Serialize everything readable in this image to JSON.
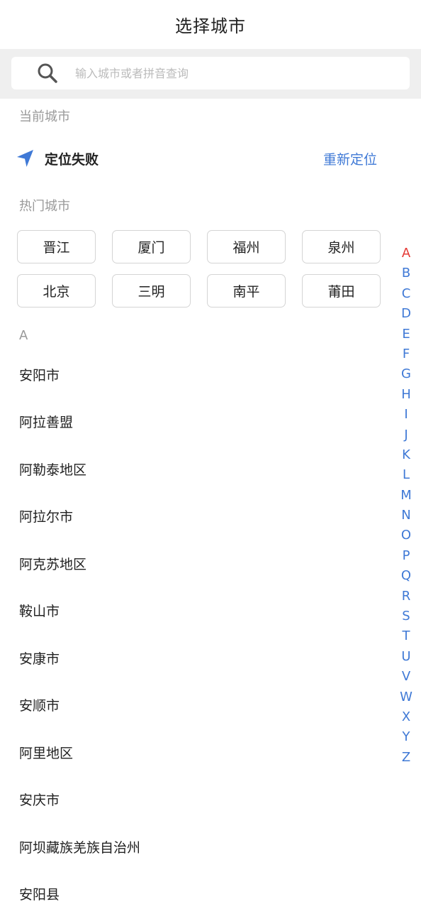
{
  "header": {
    "title": "选择城市"
  },
  "search": {
    "placeholder": "输入城市或者拼音查询",
    "icon": "search-icon"
  },
  "current_city": {
    "label": "当前城市",
    "status": "定位失败",
    "relocate_label": "重新定位",
    "icon": "location-arrow-icon"
  },
  "hot_cities": {
    "label": "热门城市",
    "items": [
      "晋江",
      "厦门",
      "福州",
      "泉州",
      "北京",
      "三明",
      "南平",
      "莆田"
    ]
  },
  "city_group": {
    "letter": "A",
    "items": [
      "安阳市",
      "阿拉善盟",
      "阿勒泰地区",
      "阿拉尔市",
      "阿克苏地区",
      "鞍山市",
      "安康市",
      "安顺市",
      "阿里地区",
      "安庆市",
      "阿坝藏族羌族自治州",
      "安阳县"
    ]
  },
  "alphabet_index": {
    "active": "A",
    "letters": [
      "A",
      "B",
      "C",
      "D",
      "E",
      "F",
      "G",
      "H",
      "I",
      "J",
      "K",
      "L",
      "M",
      "N",
      "O",
      "P",
      "Q",
      "R",
      "S",
      "T",
      "U",
      "V",
      "W",
      "X",
      "Y",
      "Z"
    ]
  },
  "colors": {
    "accent": "#3f79d6",
    "active_letter": "#e53935",
    "muted": "#999999",
    "band": "#efefef"
  }
}
